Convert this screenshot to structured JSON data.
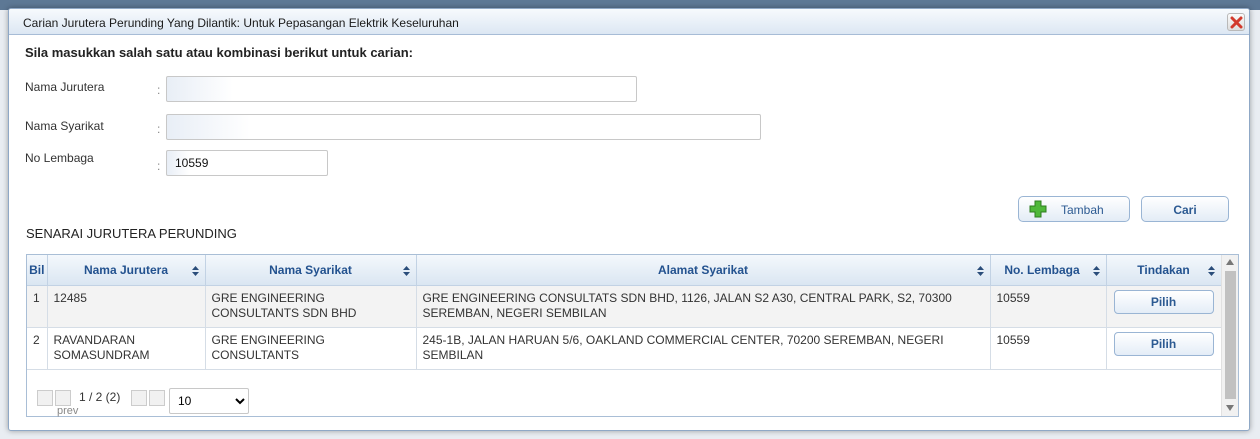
{
  "dialog": {
    "title": "Carian Jurutera Perunding Yang Dilantik: Untuk Pepasangan Elektrik Keseluruhan",
    "close_icon": "close-x-icon",
    "close_color": "#d23a2c"
  },
  "search": {
    "instruction": "Sila masukkan salah satu atau kombinasi berikut untuk carian:",
    "fields": [
      {
        "label": "Nama Jurutera",
        "colon": ":",
        "value": ""
      },
      {
        "label": "Nama Syarikat",
        "colon": ":",
        "value": ""
      },
      {
        "label": "No Lembaga",
        "colon": ":",
        "value": "10559"
      }
    ]
  },
  "buttons": {
    "tambah": "Tambah",
    "tambah_icon": "green-plus-icon",
    "cari": "Cari"
  },
  "section_title": "SENARAI JURUTERA PERUNDING",
  "table": {
    "headers": [
      "Bil",
      "Nama Jurutera",
      "Nama Syarikat",
      "Alamat Syarikat",
      "No. Lembaga",
      "Tindakan"
    ],
    "rows": [
      {
        "bil": "1",
        "nama_jurutera": "12485",
        "nama_syarikat": "GRE ENGINEERING CONSULTANTS SDN BHD",
        "alamat": "GRE ENGINEERING CONSULTATS SDN BHD, 1126, JALAN S2 A30, CENTRAL PARK, S2, 70300 SEREMBAN, NEGERI SEMBILAN",
        "no_lembaga": "10559",
        "action": "Pilih"
      },
      {
        "bil": "2",
        "nama_jurutera": "RAVANDARAN SOMASUNDRAM",
        "nama_syarikat": "GRE ENGINEERING CONSULTANTS",
        "alamat": "245-1B, JALAN HARUAN 5/6, OAKLAND COMMERCIAL CENTER, 70200 SEREMBAN, NEGERI SEMBILAN",
        "no_lembaga": "10559",
        "action": "Pilih"
      }
    ]
  },
  "pager": {
    "info": "1 / 2 (2)",
    "prev_alt": "prev",
    "page_size": "10",
    "page_size_options": [
      "10"
    ]
  },
  "colors": {
    "accent": "#23528f",
    "header_bg": "#dae6f2",
    "border": "#a9bed6"
  }
}
